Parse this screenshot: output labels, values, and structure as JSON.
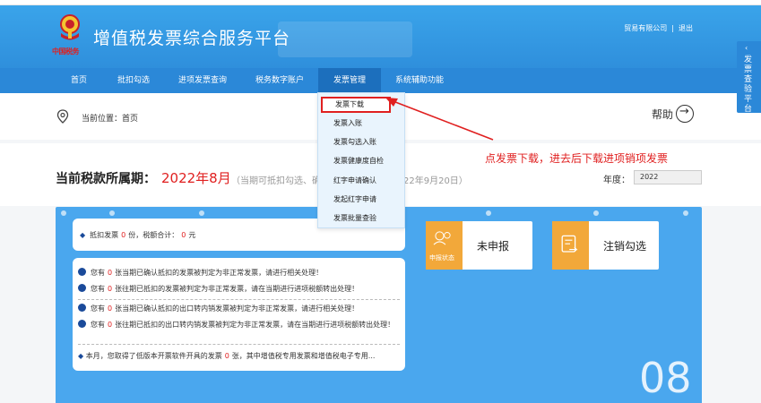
{
  "header": {
    "emblem_text": "中国税务",
    "title": "增值税发票综合服务平台",
    "company": "贸易有限公司",
    "separator": "|",
    "logout": "退出"
  },
  "nav": {
    "items": [
      {
        "label": "首页",
        "width": 54
      },
      {
        "label": "批扣勾选",
        "width": 68
      },
      {
        "label": "进项发票查询",
        "width": 86
      },
      {
        "label": "税务数字账户",
        "width": 86
      },
      {
        "label": "发票管理",
        "width": 70,
        "active": true
      },
      {
        "label": "系统辅助功能",
        "width": 86
      }
    ]
  },
  "breadcrumb": {
    "label": "当前位置：首页",
    "help": "帮助"
  },
  "dropdown": {
    "items": [
      "发票下载",
      "发票入账",
      "发票勾选入账",
      "发票健康度自检",
      "红字申请确认",
      "发起红字申请",
      "发票批量查验"
    ]
  },
  "annotation": {
    "text": "点发票下载，进去后下载进项销项发票"
  },
  "period": {
    "label": "当前税款所属期：",
    "value": "2022年8月",
    "note_start": "（当期可抵扣勾选、确",
    "note_end": "22年9月20日）",
    "year_label": "年度：",
    "year_value": "2022"
  },
  "summary": {
    "prefix": "抵扣发票",
    "count": "0",
    "unit": "份，税额合计：",
    "amount": "0",
    "currency": "元"
  },
  "messages": [
    {
      "pre": "您有",
      "num": "0",
      "post": "张当期已确认抵扣的发票被判定为非正常发票，请进行相关处理！"
    },
    {
      "pre": "您有",
      "num": "0",
      "post": "张往期已抵扣的发票被判定为非正常发票，请在当期进行进项税额转出处理！"
    },
    {
      "pre": "您有",
      "num": "0",
      "post": "张当期已确认抵扣的出口转内销发票被判定为非正常发票，请进行相关处理！"
    },
    {
      "pre": "您有",
      "num": "0",
      "post": "张往期已抵扣的出口转内销发票被判定为非正常发票，请在当期进行进项税额转出处理！"
    },
    {
      "pre": "本月，您取得了低版本开票软件开具的发票",
      "num": "0",
      "post": "张，其中增值税专用发票和增值税电子专用..."
    }
  ],
  "tiles": [
    {
      "label": "未申报",
      "sub": "申报状态",
      "icon": "declare-status-icon"
    },
    {
      "label": "注销勾选",
      "sub": "",
      "icon": "cancel-check-icon"
    }
  ],
  "month_number": "08",
  "side_tab": {
    "arrow": "‹",
    "text": "发票查验平台"
  },
  "colors": {
    "header_blue": "#3aa4ea",
    "nav_blue": "#2b88d8",
    "nav_active": "#1c6fbd",
    "panel_blue": "#4aa7ee",
    "accent_red": "#e02020",
    "tile_orange": "#f2a83a"
  }
}
